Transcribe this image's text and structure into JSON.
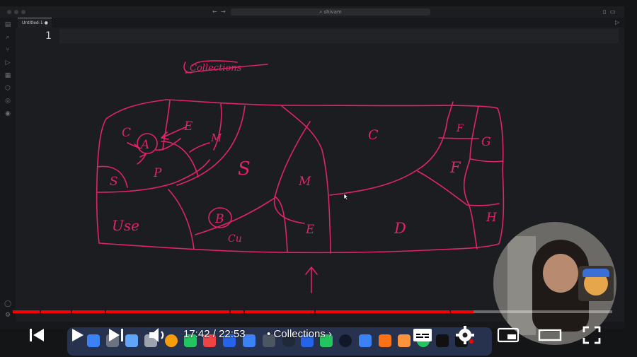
{
  "window": {
    "search_text": "shivam"
  },
  "editor": {
    "tab_label": "Untitled-1",
    "line_number": "1"
  },
  "drawing": {
    "title_text": "Collections",
    "labels": [
      "C",
      "E",
      "A",
      "M",
      "S",
      "P",
      "S",
      "C",
      "M",
      "F",
      "G",
      "F",
      "Use",
      "B",
      "Cu",
      "E",
      "D",
      "H"
    ]
  },
  "player": {
    "time": "17:42 / 22:53",
    "chapter_separator": "•",
    "chapter": "Collections",
    "progress_fraction": 0.7687,
    "chapter_markers": [
      0.0443,
      0.0969,
      0.1536,
      0.3614,
      0.3851,
      0.5035,
      0.7285
    ]
  },
  "colors": {
    "ink": "#e0246a",
    "progress": "#ff0000",
    "editor_bg": "#1c1d21"
  }
}
